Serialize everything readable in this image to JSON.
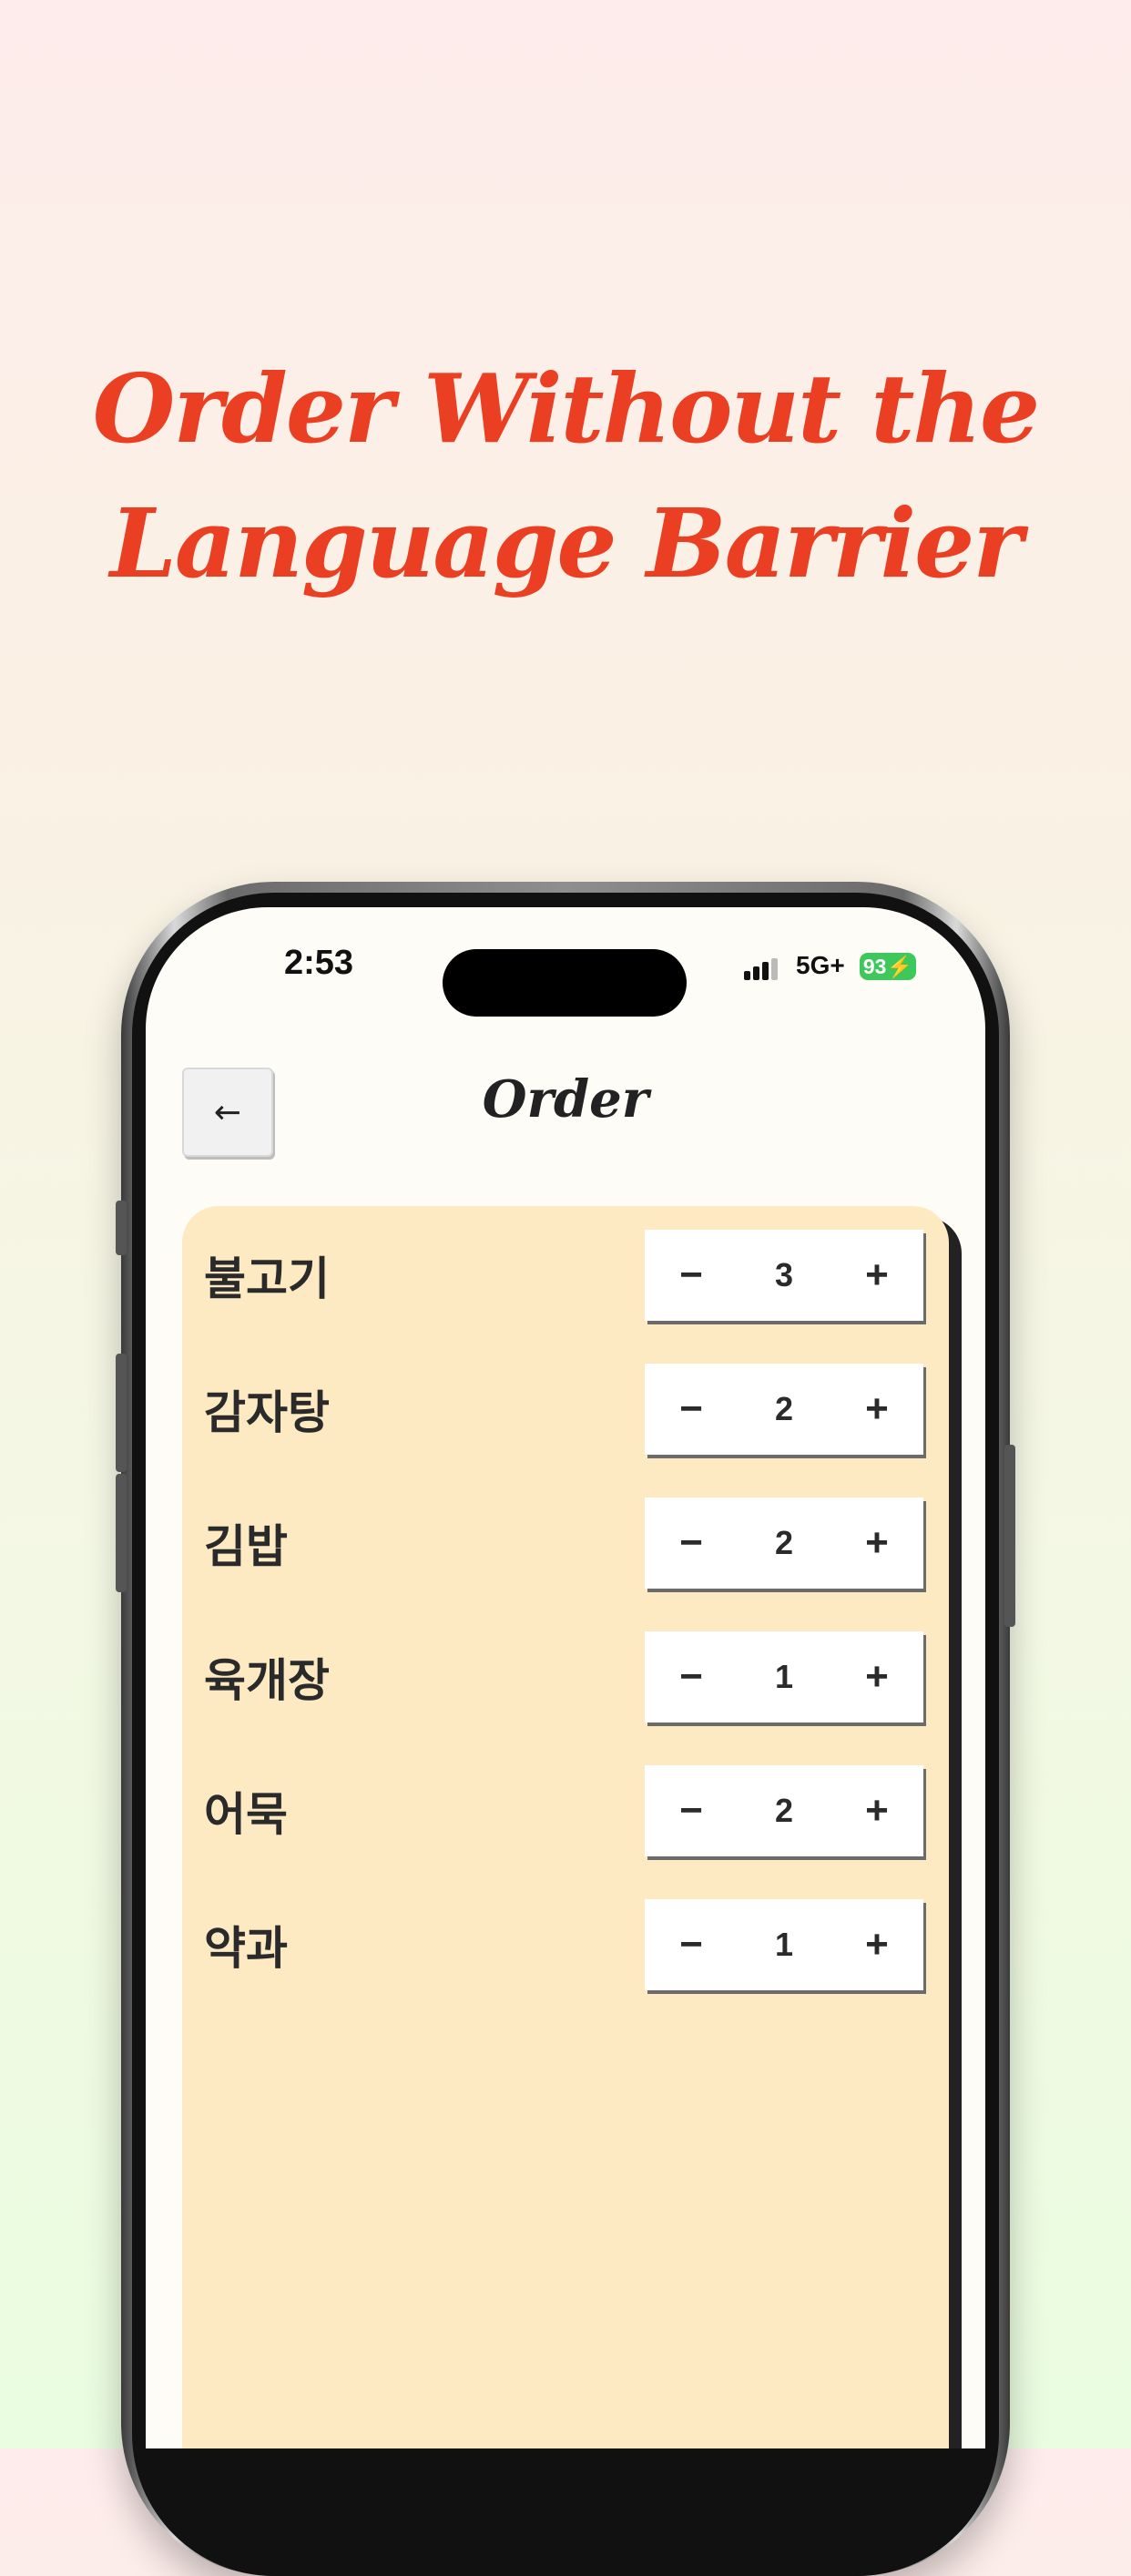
{
  "headline": {
    "line1": "Order Without the",
    "line2": "Language Barrier"
  },
  "status_bar": {
    "time": "2:53",
    "network": "5G+",
    "battery": "93⚡"
  },
  "header": {
    "back_icon": "←",
    "title": "Order"
  },
  "stepper": {
    "minus": "−",
    "plus": "+"
  },
  "order_items": [
    {
      "name": "불고기",
      "quantity": "3"
    },
    {
      "name": "감자탕",
      "quantity": "2"
    },
    {
      "name": "김밥",
      "quantity": "2"
    },
    {
      "name": "육개장",
      "quantity": "1"
    },
    {
      "name": "어묵",
      "quantity": "2"
    },
    {
      "name": "약과",
      "quantity": "1"
    }
  ],
  "colors": {
    "headline": "#ea3f22",
    "card_background": "#feeac2",
    "battery": "#3ec75a"
  }
}
